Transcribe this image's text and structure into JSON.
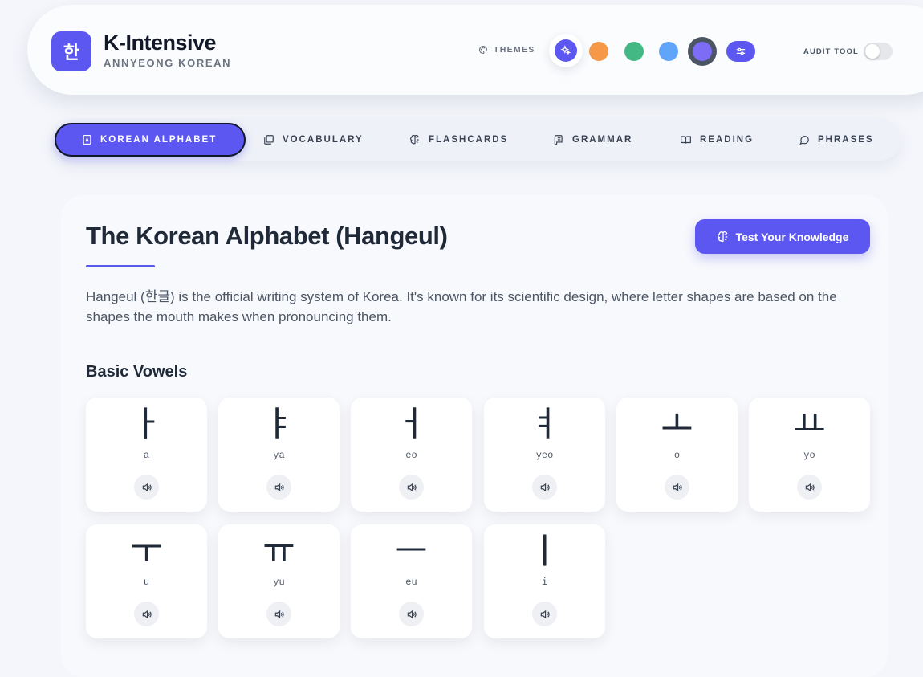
{
  "header": {
    "logo_char": "한",
    "title": "K-Intensive",
    "subtitle": "ANNYEONG KOREAN",
    "themes_label": "THEMES",
    "theme_colors": [
      "#5b57f0",
      "#f59847",
      "#44b884",
      "#60a5fa",
      "#7c6cf6"
    ],
    "audit_label": "AUDIT TOOL",
    "audit_enabled": false
  },
  "nav": {
    "items": [
      {
        "label": "KOREAN ALPHABET",
        "icon": "alphabet-icon",
        "active": true
      },
      {
        "label": "VOCABULARY",
        "icon": "cards-stack-icon",
        "active": false
      },
      {
        "label": "FLASHCARDS",
        "icon": "brain-icon",
        "active": false
      },
      {
        "label": "GRAMMAR",
        "icon": "scroll-icon",
        "active": false
      },
      {
        "label": "READING",
        "icon": "book-open-icon",
        "active": false
      },
      {
        "label": "PHRASES",
        "icon": "chat-bubble-icon",
        "active": false
      }
    ]
  },
  "main": {
    "title": "The Korean Alphabet (Hangeul)",
    "quiz_button": "Test Your Knowledge",
    "intro": "Hangeul (한글) is the official writing system of Korea. It's known for its scientific design, where letter shapes are based on the shapes the mouth makes when pronouncing them.",
    "section_title": "Basic Vowels",
    "vowels": [
      {
        "char": "ㅏ",
        "roman": "a"
      },
      {
        "char": "ㅑ",
        "roman": "ya"
      },
      {
        "char": "ㅓ",
        "roman": "eo"
      },
      {
        "char": "ㅕ",
        "roman": "yeo"
      },
      {
        "char": "ㅗ",
        "roman": "o"
      },
      {
        "char": "ㅛ",
        "roman": "yo"
      },
      {
        "char": "ㅜ",
        "roman": "u"
      },
      {
        "char": "ㅠ",
        "roman": "yu"
      },
      {
        "char": "ㅡ",
        "roman": "eu"
      },
      {
        "char": "ㅣ",
        "roman": "i"
      }
    ]
  }
}
